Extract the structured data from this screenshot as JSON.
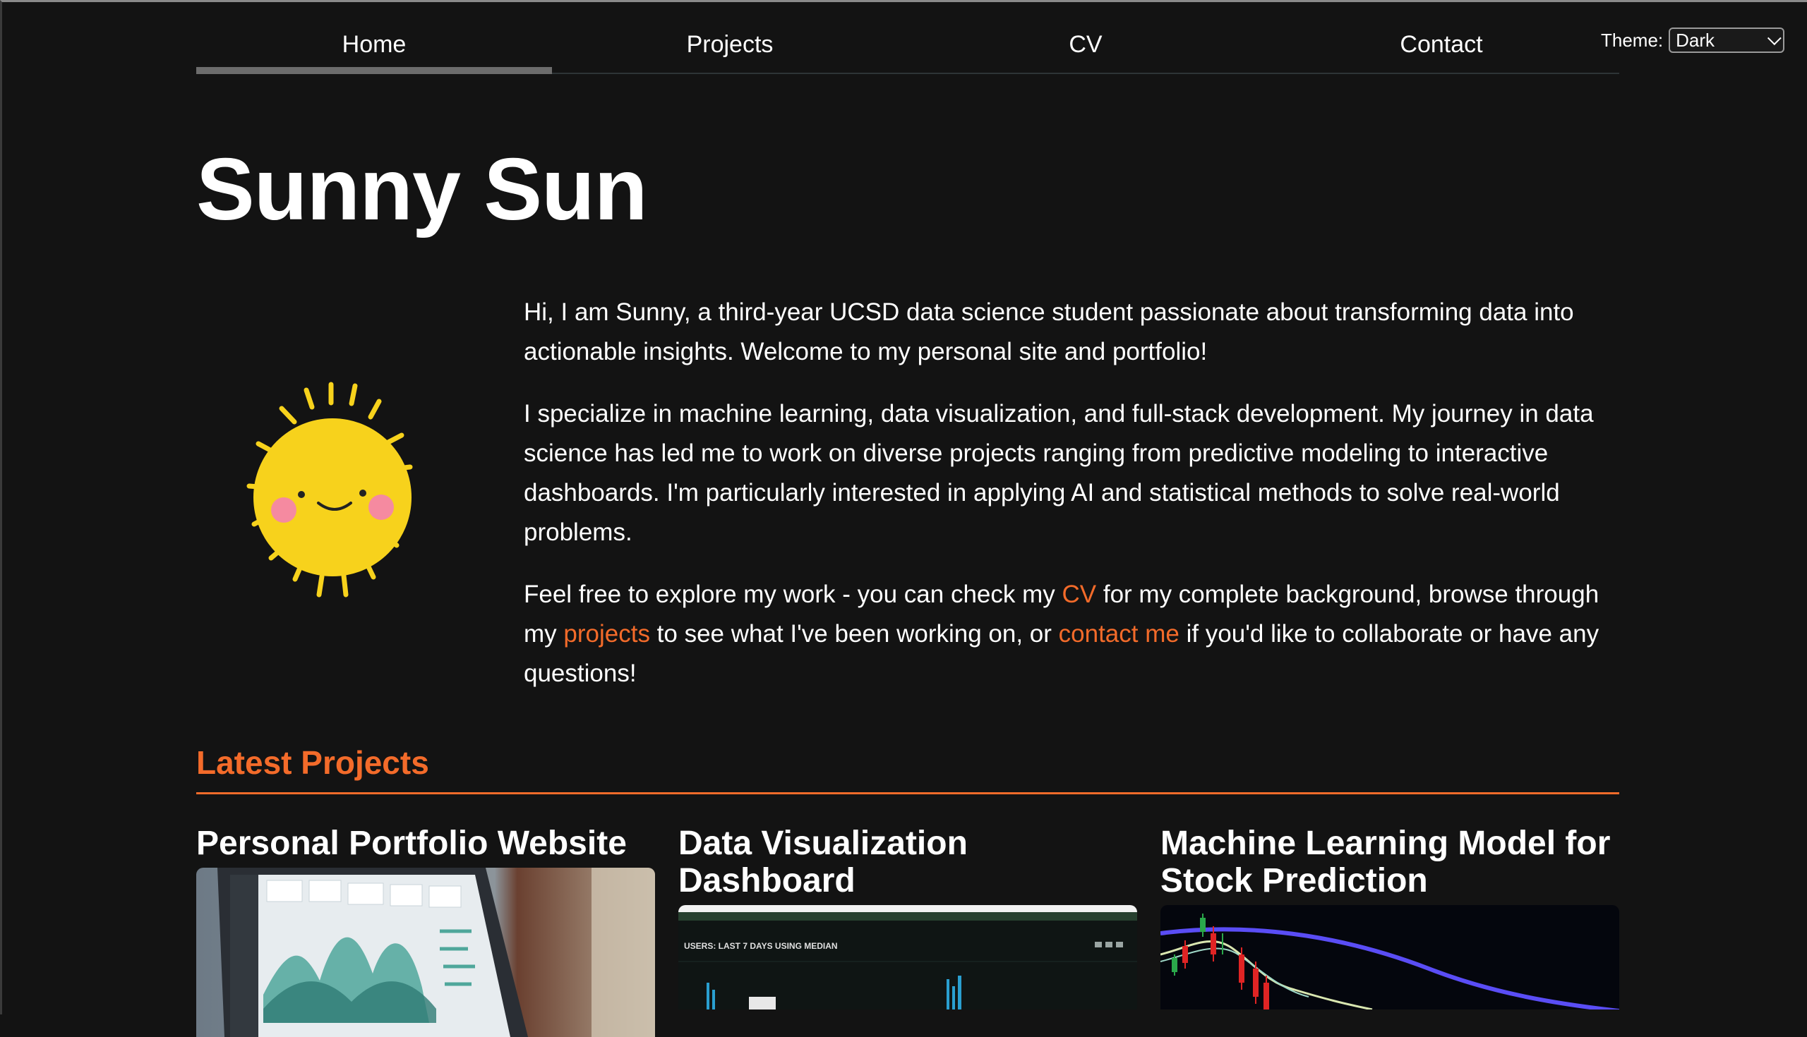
{
  "nav": {
    "items": [
      {
        "label": "Home",
        "active": true
      },
      {
        "label": "Projects"
      },
      {
        "label": "CV"
      },
      {
        "label": "Contact"
      }
    ]
  },
  "theme": {
    "label": "Theme:",
    "selected": "Dark"
  },
  "hero": {
    "name": "Sunny Sun"
  },
  "intro": {
    "p1": "Hi, I am Sunny, a third-year UCSD data science student passionate about transforming data into actionable insights. Welcome to my personal site and portfolio!",
    "p2": "I specialize in machine learning, data visualization, and full-stack development. My journey in data science has led me to work on diverse projects ranging from predictive modeling to interactive dashboards. I'm particularly interested in applying AI and statistical methods to solve real-world problems.",
    "p3_a": "Feel free to explore my work - you can check my ",
    "p3_cv": "CV",
    "p3_b": " for my complete background, browse through my ",
    "p3_projects": "projects",
    "p3_c": " to see what I've been working on, or ",
    "p3_contact": "contact me",
    "p3_d": " if you'd like to collaborate or have any questions!"
  },
  "latest": {
    "heading": "Latest Projects",
    "projects": [
      {
        "title": "Personal Portfolio Website"
      },
      {
        "title": "Data Visualization Dashboard"
      },
      {
        "title": "Machine Learning Model for Stock Prediction"
      }
    ]
  },
  "colors": {
    "accent": "#f36b2a",
    "background": "#131313",
    "sun": "#f7d21c"
  }
}
